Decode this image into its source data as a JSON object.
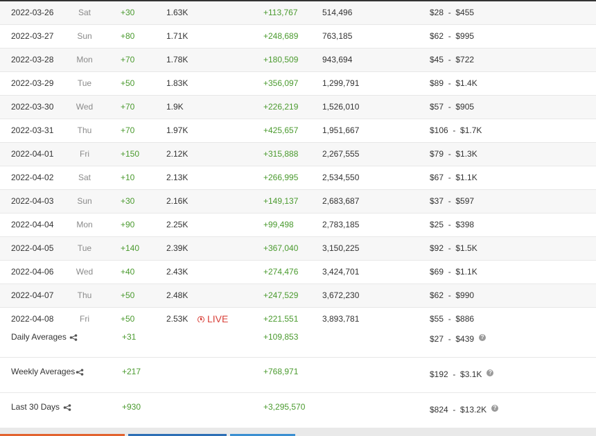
{
  "rows": [
    {
      "date": "2022-03-26",
      "day": "Sat",
      "sub_change": "+30",
      "sub_total": "1.63K",
      "views_change": "+113,767",
      "views_total": "514,496",
      "earn_low": "$28",
      "earn_high": "$455"
    },
    {
      "date": "2022-03-27",
      "day": "Sun",
      "sub_change": "+80",
      "sub_total": "1.71K",
      "views_change": "+248,689",
      "views_total": "763,185",
      "earn_low": "$62",
      "earn_high": "$995"
    },
    {
      "date": "2022-03-28",
      "day": "Mon",
      "sub_change": "+70",
      "sub_total": "1.78K",
      "views_change": "+180,509",
      "views_total": "943,694",
      "earn_low": "$45",
      "earn_high": "$722"
    },
    {
      "date": "2022-03-29",
      "day": "Tue",
      "sub_change": "+50",
      "sub_total": "1.83K",
      "views_change": "+356,097",
      "views_total": "1,299,791",
      "earn_low": "$89",
      "earn_high": "$1.4K"
    },
    {
      "date": "2022-03-30",
      "day": "Wed",
      "sub_change": "+70",
      "sub_total": "1.9K",
      "views_change": "+226,219",
      "views_total": "1,526,010",
      "earn_low": "$57",
      "earn_high": "$905"
    },
    {
      "date": "2022-03-31",
      "day": "Thu",
      "sub_change": "+70",
      "sub_total": "1.97K",
      "views_change": "+425,657",
      "views_total": "1,951,667",
      "earn_low": "$106",
      "earn_high": "$1.7K"
    },
    {
      "date": "2022-04-01",
      "day": "Fri",
      "sub_change": "+150",
      "sub_total": "2.12K",
      "views_change": "+315,888",
      "views_total": "2,267,555",
      "earn_low": "$79",
      "earn_high": "$1.3K"
    },
    {
      "date": "2022-04-02",
      "day": "Sat",
      "sub_change": "+10",
      "sub_total": "2.13K",
      "views_change": "+266,995",
      "views_total": "2,534,550",
      "earn_low": "$67",
      "earn_high": "$1.1K"
    },
    {
      "date": "2022-04-03",
      "day": "Sun",
      "sub_change": "+30",
      "sub_total": "2.16K",
      "views_change": "+149,137",
      "views_total": "2,683,687",
      "earn_low": "$37",
      "earn_high": "$597"
    },
    {
      "date": "2022-04-04",
      "day": "Mon",
      "sub_change": "+90",
      "sub_total": "2.25K",
      "views_change": "+99,498",
      "views_total": "2,783,185",
      "earn_low": "$25",
      "earn_high": "$398"
    },
    {
      "date": "2022-04-05",
      "day": "Tue",
      "sub_change": "+140",
      "sub_total": "2.39K",
      "views_change": "+367,040",
      "views_total": "3,150,225",
      "earn_low": "$92",
      "earn_high": "$1.5K"
    },
    {
      "date": "2022-04-06",
      "day": "Wed",
      "sub_change": "+40",
      "sub_total": "2.43K",
      "views_change": "+274,476",
      "views_total": "3,424,701",
      "earn_low": "$69",
      "earn_high": "$1.1K"
    },
    {
      "date": "2022-04-07",
      "day": "Thu",
      "sub_change": "+50",
      "sub_total": "2.48K",
      "views_change": "+247,529",
      "views_total": "3,672,230",
      "earn_low": "$62",
      "earn_high": "$990"
    },
    {
      "date": "2022-04-08",
      "day": "Fri",
      "sub_change": "+50",
      "sub_total": "2.53K",
      "live": "LIVE",
      "views_change": "+221,551",
      "views_total": "3,893,781",
      "earn_low": "$55",
      "earn_high": "$886"
    }
  ],
  "earn_separator": "-",
  "summary": {
    "daily": {
      "label": "Daily Averages",
      "sub": "+31",
      "views": "+109,853",
      "earn_low": "$27",
      "earn_high": "$439"
    },
    "weekly": {
      "label": "Weekly Averages",
      "sub": "+217",
      "views": "+768,971",
      "earn_low": "$192",
      "earn_high": "$3.1K"
    },
    "last30": {
      "label": "Last 30 Days",
      "sub": "+930",
      "views": "+3,295,570",
      "earn_low": "$824",
      "earn_high": "$13.2K"
    }
  },
  "icons": {
    "share": "share-icon",
    "help": "help-icon",
    "live": "clock-icon"
  },
  "help_glyph": "?",
  "colors": {
    "positive": "#4a9a2e",
    "live": "#d9413a",
    "footer_btn_1": "#e2632f",
    "footer_btn_2": "#2d6fb5",
    "footer_btn_3": "#3b8fd1"
  }
}
